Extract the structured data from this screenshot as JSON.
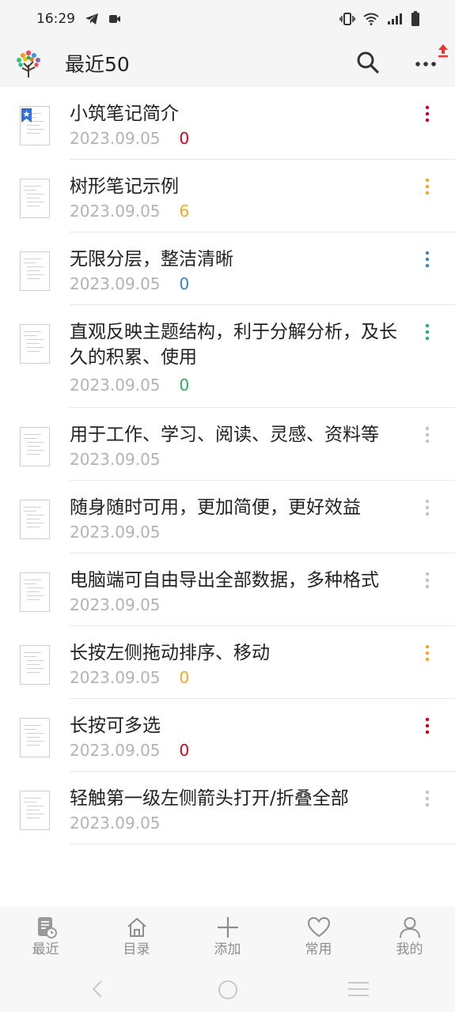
{
  "status_bar": {
    "time": "16:29"
  },
  "app_bar": {
    "title": "最近50"
  },
  "notes": [
    {
      "title": "小筑笔记简介",
      "date": "2023.09.05",
      "count": "0",
      "count_color": "#d0021b",
      "dots_color": "#d0021b",
      "bookmark": true
    },
    {
      "title": "树形笔记示例",
      "date": "2023.09.05",
      "count": "6",
      "count_color": "#f5a623",
      "dots_color": "#f5a623",
      "bookmark": false
    },
    {
      "title": "无限分层，整洁清晰",
      "date": "2023.09.05",
      "count": "0",
      "count_color": "#3b84c4",
      "dots_color": "#3b84c4",
      "bookmark": false
    },
    {
      "title": "直观反映主题结构，利于分解分析，及长久的积累、使用",
      "date": "2023.09.05",
      "count": "0",
      "count_color": "#27ae60",
      "dots_color": "#27ae60",
      "bookmark": false
    },
    {
      "title": "用于工作、学习、阅读、灵感、资料等",
      "date": "2023.09.05",
      "count": "",
      "count_color": "#b3b3b3",
      "dots_color": "#c4c4c4",
      "bookmark": false
    },
    {
      "title": "随身随时可用，更加简便，更好效益",
      "date": "2023.09.05",
      "count": "",
      "count_color": "#b3b3b3",
      "dots_color": "#c4c4c4",
      "bookmark": false
    },
    {
      "title": "电脑端可自由导出全部数据，多种格式",
      "date": "2023.09.05",
      "count": "",
      "count_color": "#b3b3b3",
      "dots_color": "#c4c4c4",
      "bookmark": false
    },
    {
      "title": "长按左侧拖动排序、移动",
      "date": "2023.09.05",
      "count": "0",
      "count_color": "#f5a623",
      "dots_color": "#f5a623",
      "bookmark": false
    },
    {
      "title": "长按可多选",
      "date": "2023.09.05",
      "count": "0",
      "count_color": "#d0021b",
      "dots_color": "#d0021b",
      "bookmark": false
    },
    {
      "title": "轻触第一级左侧箭头打开/折叠全部",
      "date": "2023.09.05",
      "count": "",
      "count_color": "#b3b3b3",
      "dots_color": "#c4c4c4",
      "bookmark": false
    }
  ],
  "bottom_nav": {
    "items": [
      {
        "label": "最近",
        "icon": "recent-icon"
      },
      {
        "label": "目录",
        "icon": "home-icon"
      },
      {
        "label": "添加",
        "icon": "plus-icon"
      },
      {
        "label": "常用",
        "icon": "heart-icon"
      },
      {
        "label": "我的",
        "icon": "user-icon"
      }
    ]
  }
}
